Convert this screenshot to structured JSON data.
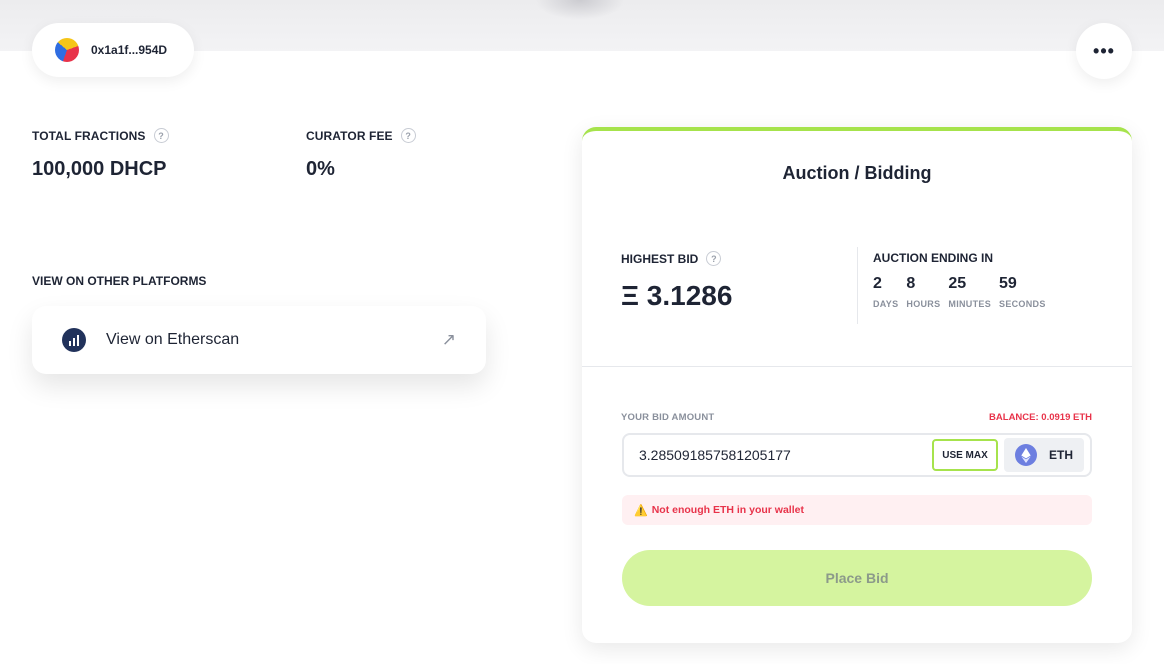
{
  "wallet": {
    "address": "0x1a1f...954D"
  },
  "menu": {
    "more_label": "•••"
  },
  "stats": [
    {
      "label": "TOTAL FRACTIONS",
      "value": "100,000 DHCP"
    },
    {
      "label": "CURATOR FEE",
      "value": "0%"
    }
  ],
  "help_glyph": "?",
  "platforms": {
    "label": "VIEW ON OTHER PLATFORMS",
    "etherscan_label": "View on Etherscan",
    "arrow_glyph": "↗"
  },
  "auction": {
    "title": "Auction / Bidding",
    "highest_bid_label": "HIGHEST BID",
    "highest_bid_value": "Ξ 3.1286",
    "ending_label": "AUCTION ENDING IN",
    "countdown": [
      {
        "value": "2",
        "unit": "DAYS"
      },
      {
        "value": "8",
        "unit": "HOURS"
      },
      {
        "value": "25",
        "unit": "MINUTES"
      },
      {
        "value": "59",
        "unit": "SECONDS"
      }
    ]
  },
  "bid": {
    "amount_label": "YOUR BID AMOUNT",
    "balance": "BALANCE: 0.0919 ETH",
    "input_value": "3.285091857581205177",
    "use_max_label": "USE MAX",
    "token": "ETH",
    "warning_icon": "⚠️",
    "warning": "Not enough ETH in your wallet",
    "place_bid_label": "Place Bid"
  },
  "colors": {
    "accent": "#a6e34c",
    "button_disabled": "#d5f49f",
    "error": "#e8334a",
    "text": "#1e2434",
    "muted": "#8a909c"
  },
  "icons": [
    "wallet-avatar-icon",
    "more-icon",
    "help-icon",
    "etherscan-icon",
    "external-link-icon",
    "eth-icon",
    "warning-icon"
  ]
}
